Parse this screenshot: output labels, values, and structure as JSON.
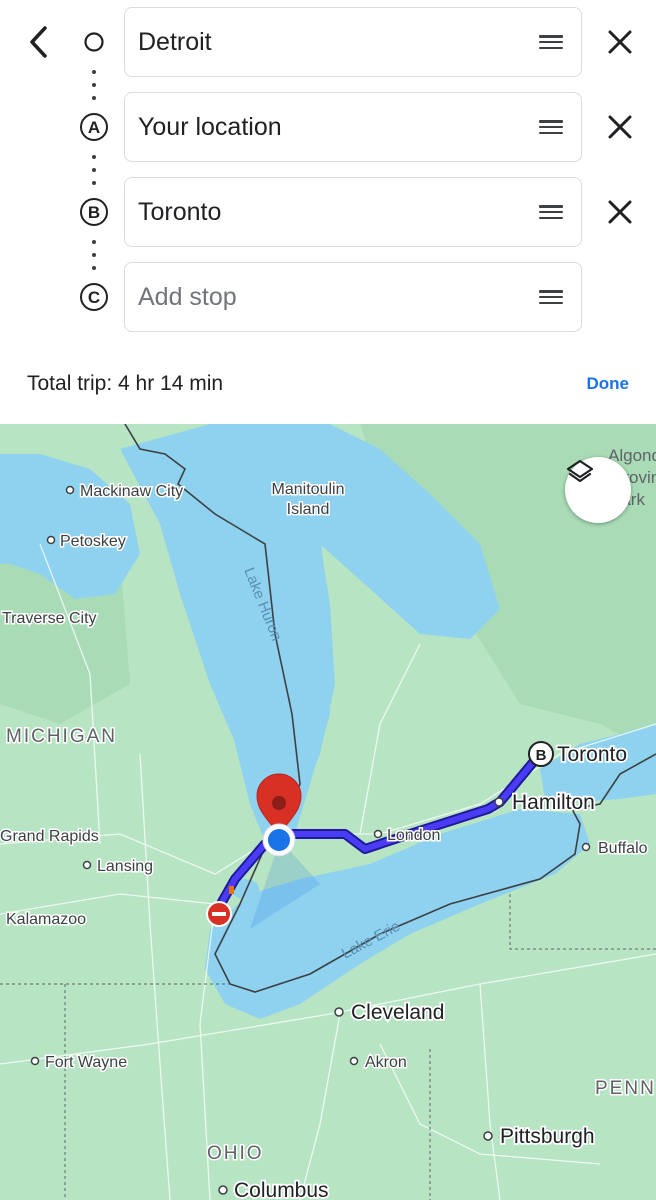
{
  "header": {
    "back_icon": "arrow-back-icon",
    "stops": [
      {
        "marker": "",
        "value": "Detroit",
        "placeholder": "",
        "removable": true
      },
      {
        "marker": "A",
        "value": "Your location",
        "placeholder": "",
        "removable": true
      },
      {
        "marker": "B",
        "value": "Toronto",
        "placeholder": "",
        "removable": true
      },
      {
        "marker": "C",
        "value": "",
        "placeholder": "Add stop",
        "removable": false
      }
    ],
    "total_trip": "Total trip: 4 hr 14 min",
    "done_label": "Done"
  },
  "map": {
    "colors": {
      "land": "#b7e4c3",
      "water": "#8fd2ef",
      "route": "#3b2ee6",
      "route_outline": "#1f1a9a",
      "pin": "#d93025",
      "location": "#1a73e8"
    },
    "labels": {
      "mackinaw_city": "Mackinaw City",
      "manitoulin_island": "Manitoulin\nIsland",
      "petoskey": "Petoskey",
      "traverse_city": "Traverse City",
      "lake_huron": "Lake Huron",
      "michigan": "MICHIGAN",
      "grand_rapids": "Grand Rapids",
      "lansing": "Lansing",
      "kalamazoo": "Kalamazoo",
      "london": "London",
      "hamilton": "Hamilton",
      "toronto": "Toronto",
      "buffalo": "Buffalo",
      "lake_erie": "Lake Erie",
      "cleveland": "Cleveland",
      "akron": "Akron",
      "fort_wayne": "Fort Wayne",
      "pittsburgh": "Pittsburgh",
      "ohio": "OHIO",
      "columbus": "Columbus",
      "penn": "PENN",
      "algonquin_partial": "Algonqu\nProvinc\nPark"
    },
    "toronto_marker": "B",
    "layers_icon": "layers-icon"
  }
}
